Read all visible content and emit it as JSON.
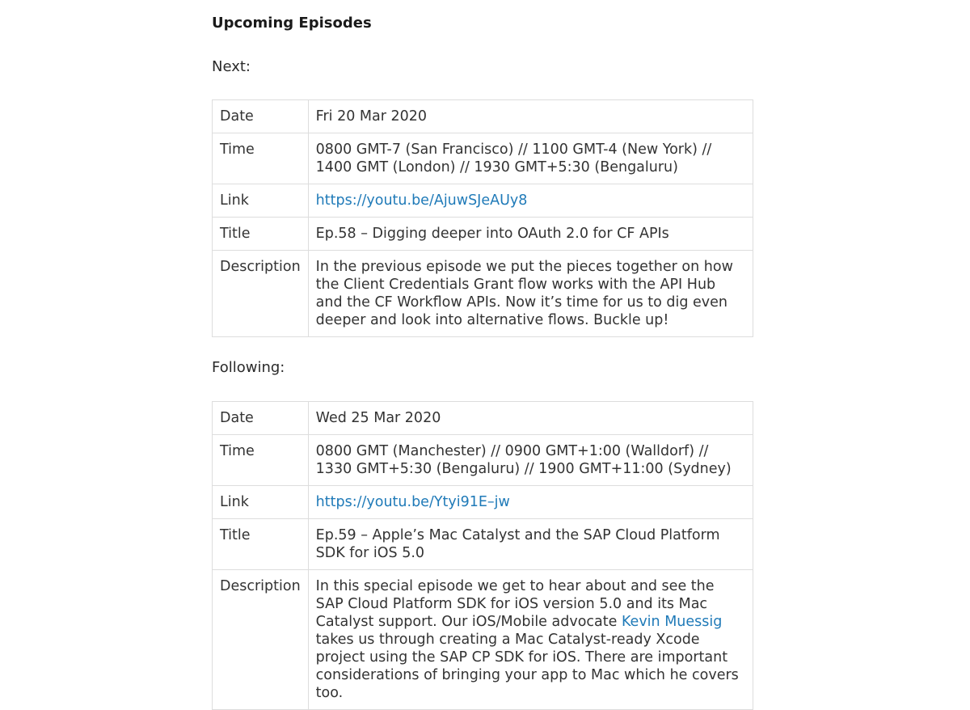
{
  "heading": "Upcoming Episodes",
  "next": {
    "label": "Next:",
    "rows": {
      "date_key": "Date",
      "date": "Fri 20 Mar 2020",
      "time_key": "Time",
      "time": "0800 GMT-7 (San Francisco) // 1100 GMT-4 (New York) // 1400 GMT (London) // 1930 GMT+5:30 (Bengaluru)",
      "link_key": "Link",
      "link": "https://youtu.be/AjuwSJeAUy8",
      "title_key": "Title",
      "title": "Ep.58 – Digging deeper into OAuth 2.0 for CF APIs",
      "description_key": "Description",
      "description": "In the previous episode we put the pieces together on how the Client Credentials Grant flow works with the API Hub and the CF Workflow APIs. Now it’s time for us to dig even deeper and look into alternative flows. Buckle up!"
    }
  },
  "following": {
    "label": "Following:",
    "rows": {
      "date_key": "Date",
      "date": "Wed 25 Mar 2020",
      "time_key": "Time",
      "time": "0800 GMT (Manchester) // 0900 GMT+1:00 (Walldorf) // 1330 GMT+5:30 (Bengaluru) // 1900 GMT+11:00 (Sydney)",
      "link_key": "Link",
      "link": "https://youtu.be/Ytyi91E–jw",
      "title_key": "Title",
      "title": "Ep.59 – Apple’s Mac Catalyst and the SAP Cloud Platform SDK for iOS 5.0",
      "description_key": "Description",
      "description_part1": "In this special episode we get to hear about and see the SAP Cloud Platform SDK for iOS version 5.0 and its Mac Catalyst support. Our iOS/Mobile advocate ",
      "description_link": "Kevin Muessig",
      "description_part2": " takes us through creating a Mac Catalyst-ready Xcode project using the SAP CP SDK for iOS. There are important considerations of bringing your app to Mac which he covers too."
    }
  },
  "colors": {
    "link": "#1f7ab8",
    "border": "#dddddd",
    "text": "#333333"
  }
}
